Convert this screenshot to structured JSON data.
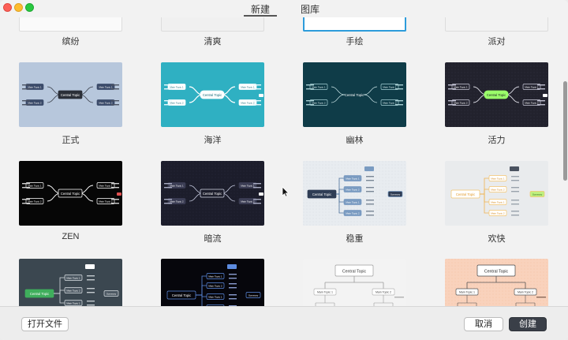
{
  "window": {
    "tabs": [
      {
        "label": "新建",
        "active": true
      },
      {
        "label": "图库",
        "active": false
      }
    ]
  },
  "top_row_labels": [
    "缤纷",
    "清爽",
    "手绘",
    "派对"
  ],
  "themes": [
    {
      "label": "正式",
      "bg": "#b7c7dc",
      "style": "formal"
    },
    {
      "label": "海洋",
      "bg": "#2fb0c2",
      "style": "ocean"
    },
    {
      "label": "幽林",
      "bg": "#0f3c48",
      "style": "forest"
    },
    {
      "label": "活力",
      "bg": "#22222d",
      "style": "vital"
    },
    {
      "label": "ZEN",
      "bg": "#060606",
      "style": "zen"
    },
    {
      "label": "暗流",
      "bg": "#1c1d2b",
      "style": "undercurrent"
    },
    {
      "label": "稳重",
      "bg": "#e8ecf0",
      "style": "steady"
    },
    {
      "label": "欢快",
      "bg": "#e9ebed",
      "style": "cheerful"
    },
    {
      "label": "",
      "bg": "#3b4750",
      "style": "green"
    },
    {
      "label": "",
      "bg": "#06060c",
      "style": "dark-blue"
    },
    {
      "label": "",
      "bg": "#f3f3f3",
      "style": "tree-white"
    },
    {
      "label": "",
      "bg": "#f9d2bc",
      "style": "tree-peach"
    }
  ],
  "node_text": {
    "central": "Central Topic",
    "main1": "Main Topic 1",
    "main2": "Main Topic 2",
    "summary": "Summary"
  },
  "footer": {
    "open_file": "打开文件",
    "cancel": "取消",
    "create": "创建"
  }
}
